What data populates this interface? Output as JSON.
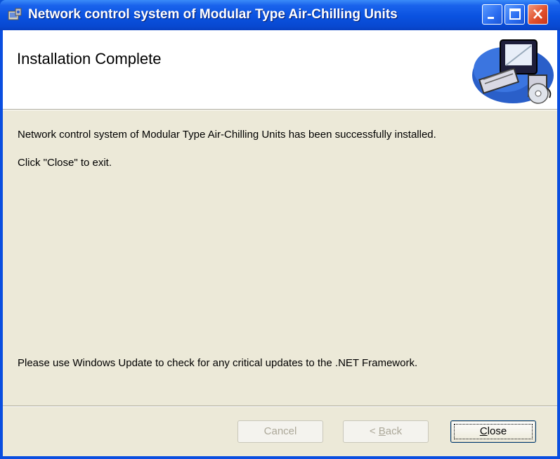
{
  "window": {
    "title": "Network control system of Modular Type Air-Chilling Units",
    "controls": [
      "minimize",
      "maximize",
      "close"
    ]
  },
  "banner": {
    "title": "Installation Complete"
  },
  "body": {
    "line1": "Network control system of Modular Type Air-Chilling Units has been successfully installed.",
    "line2": "Click \"Close\" to exit.",
    "line3": "Please use Windows Update to check for any critical updates to the .NET Framework."
  },
  "buttons": {
    "cancel": "Cancel",
    "back_prefix": "< ",
    "back_key": "B",
    "back_rest": "ack",
    "close_key": "C",
    "close_rest": "lose"
  },
  "colors": {
    "titlebar": "#0a52e0",
    "dialog_bg": "#ece9d8",
    "close_button": "#e0502c"
  }
}
